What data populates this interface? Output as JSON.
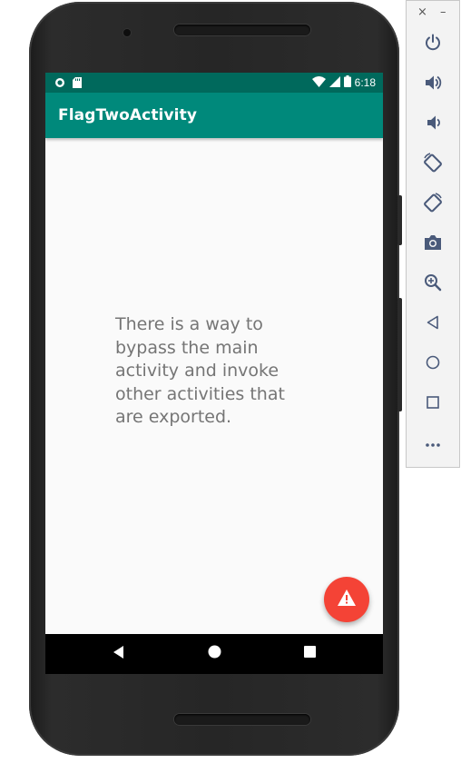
{
  "status_bar": {
    "time": "6:18",
    "left_icons": [
      "circle-notification-icon",
      "sd-card-icon"
    ],
    "right_icons": [
      "wifi-icon",
      "signal-icon",
      "battery-icon"
    ]
  },
  "app_bar": {
    "title": "FlagTwoActivity"
  },
  "content": {
    "message": "There is a way to bypass the main activity and invoke other activities that are exported."
  },
  "fab": {
    "icon": "warning-icon"
  },
  "nav_bar": {
    "buttons": [
      "back-icon",
      "home-icon",
      "recents-icon"
    ]
  },
  "emulator_toolbar": {
    "close_label": "×",
    "minimize_label": "–",
    "buttons": [
      "power-icon",
      "volume-up-icon",
      "volume-down-icon",
      "rotate-left-icon",
      "rotate-right-icon",
      "screenshot-icon",
      "zoom-icon",
      "back-icon",
      "home-icon",
      "overview-icon",
      "more-icon"
    ]
  },
  "colors": {
    "status_bar": "#00695c",
    "app_bar": "#00897b",
    "fab": "#f44336",
    "screen_bg": "#fafafa",
    "text": "#757575"
  }
}
